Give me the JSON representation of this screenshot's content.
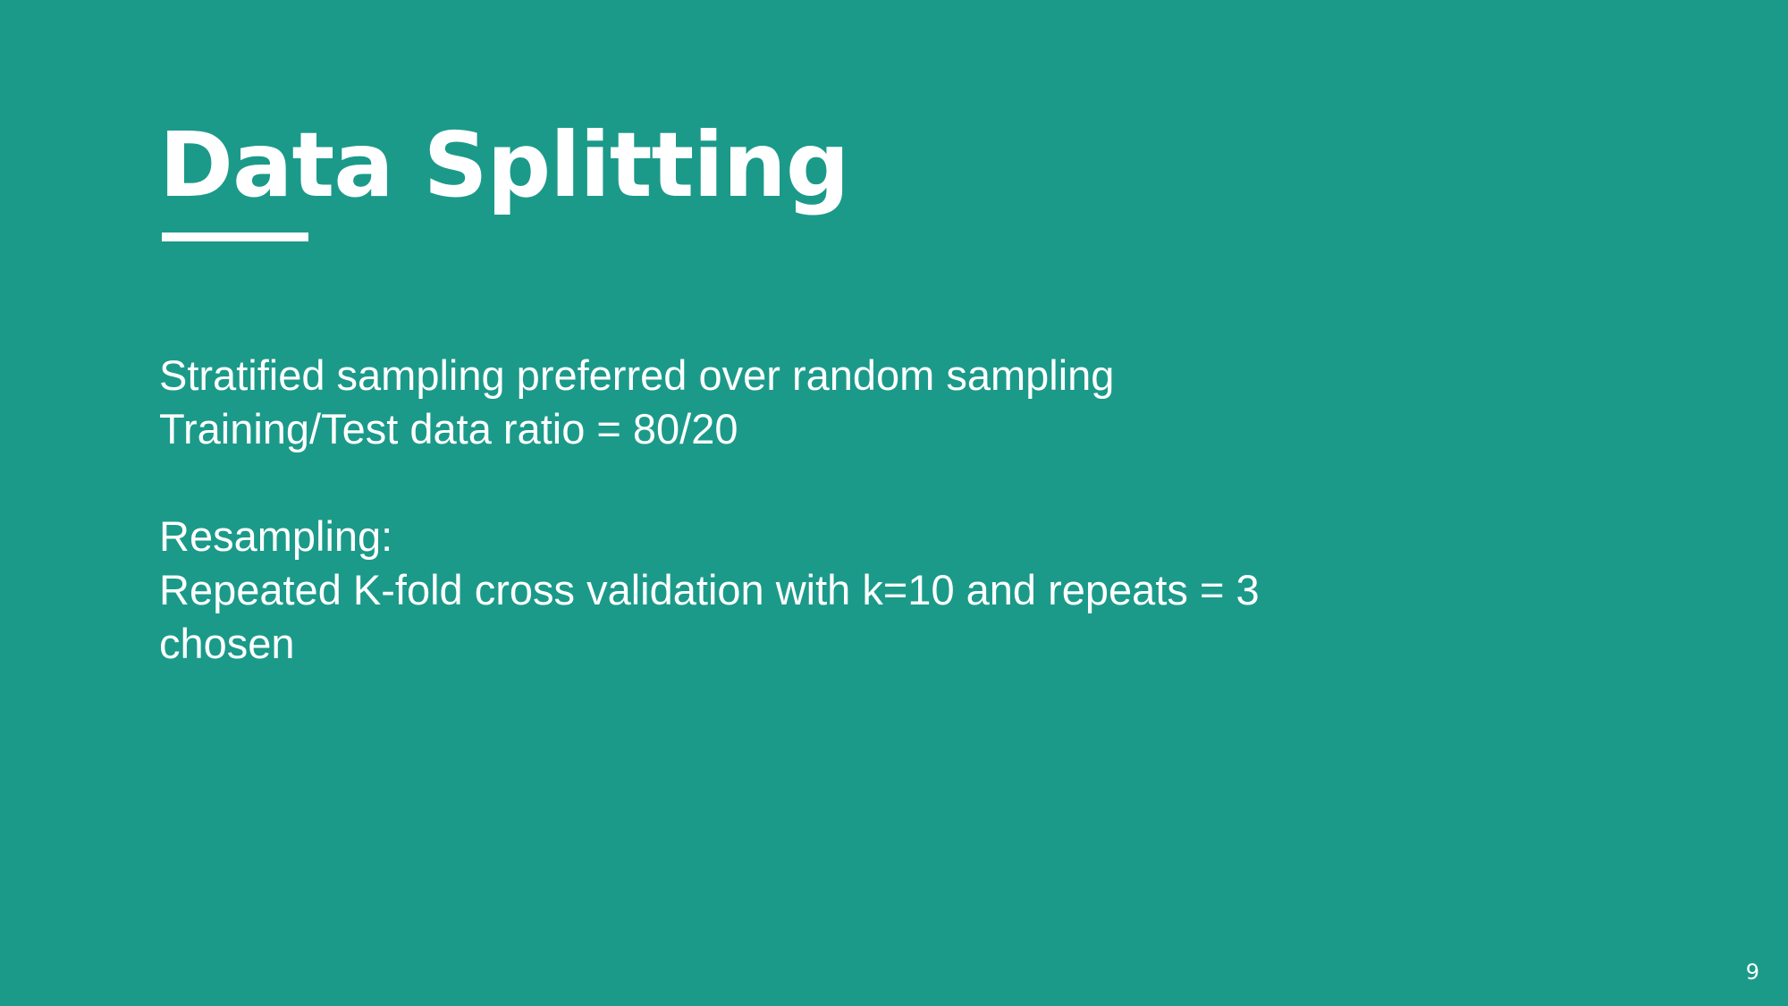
{
  "slide": {
    "title": "Data Splitting",
    "body": {
      "line1": "Stratified sampling preferred over random sampling",
      "line2": "Training/Test data ratio = 80/20",
      "line3": "Resampling:",
      "line4": "Repeated K-fold cross validation with k=10 and repeats = 3",
      "line5": "chosen"
    },
    "page_number": "9"
  },
  "colors": {
    "background": "#1b9a8a",
    "text": "#ffffff"
  }
}
